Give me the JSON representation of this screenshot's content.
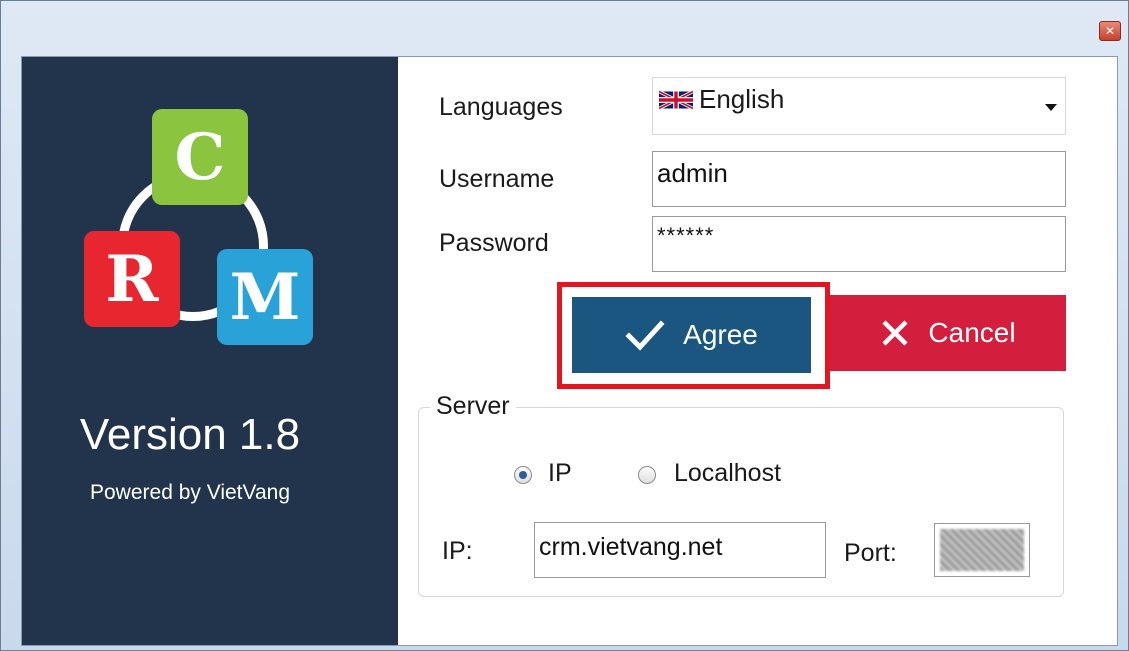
{
  "window": {
    "close_glyph": "✕"
  },
  "sidebar": {
    "logo_letters": {
      "c": "C",
      "r": "R",
      "m": "M"
    },
    "version": "Version 1.8",
    "powered_by": "Powered by VietVang"
  },
  "form": {
    "languages_label": "Languages",
    "language_value": "English",
    "language_flag_icon": "uk-flag-icon",
    "username_label": "Username",
    "username_value": "admin",
    "password_label": "Password",
    "password_value": "******"
  },
  "buttons": {
    "agree": "Agree",
    "agree_icon": "checkmark-icon",
    "cancel": "Cancel",
    "cancel_icon": "x-icon"
  },
  "server": {
    "group_title": "Server",
    "radio_ip": "IP",
    "radio_localhost": "Localhost",
    "selected": "IP",
    "ip_label": "IP:",
    "ip_value": "crm.vietvang.net",
    "port_label": "Port:"
  },
  "colors": {
    "sidebar_bg": "#21344b",
    "agree_bg": "#1a5680",
    "cancel_bg": "#d31f3d",
    "highlight": "#e1161f",
    "logo_c": "#8bc53f",
    "logo_r": "#e8262f",
    "logo_m": "#29a2d8"
  }
}
